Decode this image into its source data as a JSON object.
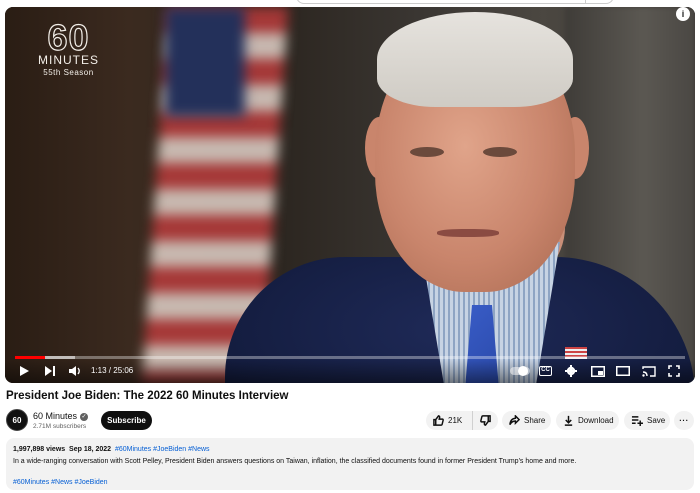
{
  "player": {
    "overlay_logo": {
      "number": "60",
      "word": "MINUTES",
      "season": "55th Season"
    },
    "info_icon": "i",
    "progress": {
      "played_fraction": 0.045,
      "loaded_fraction": 0.09
    },
    "time": "1:13 / 25:06",
    "controls": {
      "play": "play-icon",
      "next": "next-icon",
      "volume": "volume-icon",
      "autoplay": "autoplay-toggle",
      "cc": "CC",
      "settings": "gear-icon",
      "miniplayer": "miniplayer-icon",
      "theater": "theater-icon",
      "cast": "cast-icon",
      "fullscreen": "fullscreen-icon"
    }
  },
  "video": {
    "title": "President Joe Biden: The 2022 60 Minutes Interview"
  },
  "channel": {
    "avatar_text": "60",
    "name": "60 Minutes",
    "subscribers": "2.71M subscribers",
    "subscribe_label": "Subscribe"
  },
  "actions": {
    "like_count": "21K",
    "share_label": "Share",
    "download_label": "Download",
    "save_label": "Save",
    "more_label": "···"
  },
  "description": {
    "views": "1,997,898 views",
    "date": "Sep 18, 2022",
    "tags": "#60Minutes #JoeBiden #News",
    "text": "In a wide-ranging conversation with Scott Pelley, President Biden answers questions on Taiwan, inflation, the classified documents found in former President Trump's home and more.",
    "hashtags": "#60Minutes #News #JoeBiden"
  },
  "colors": {
    "progress_played": "#ff0000",
    "link": "#065fd4",
    "subscribe_bg": "#0f0f0f",
    "pill_bg": "#f2f2f2"
  }
}
